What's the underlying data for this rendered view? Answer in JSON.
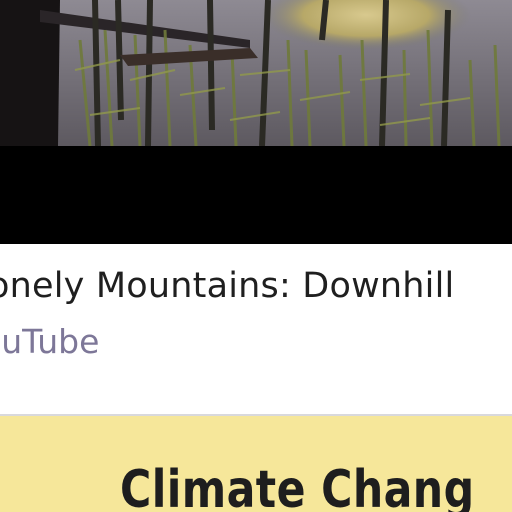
{
  "link_card": {
    "title": "onely Mountains: Downhill",
    "source": "ouTube"
  },
  "banner": {
    "title": "Climate Chang"
  },
  "colors": {
    "banner_background": "#f6e79a",
    "source_text": "#7d7798",
    "letterbox": "#000000"
  }
}
